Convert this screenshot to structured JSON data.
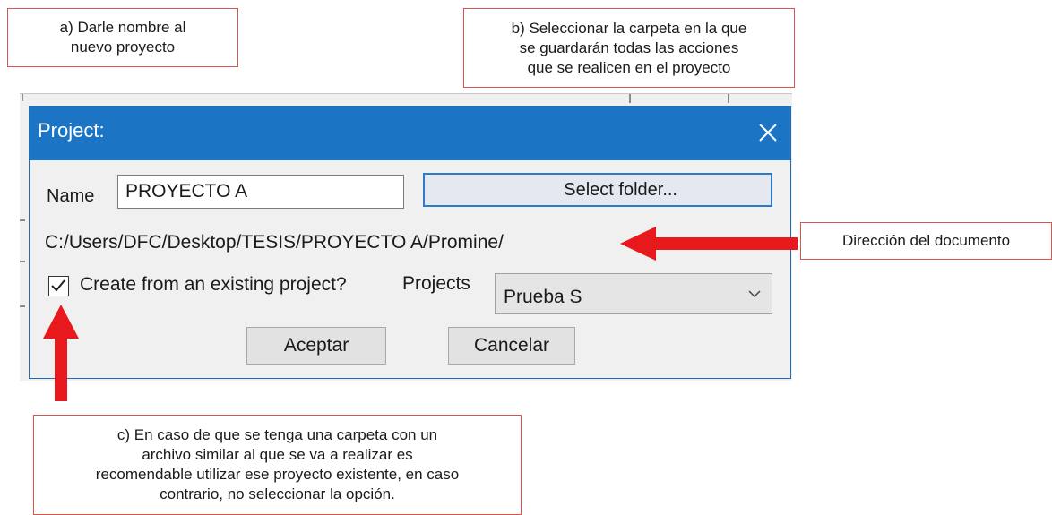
{
  "annotations": {
    "a": "a) Darle nombre al\nnuevo proyecto",
    "b": "b) Seleccionar la carpeta en la que\nse guardarán todas las acciones\nque se realicen en el proyecto",
    "direccion": "Dirección del documento",
    "c": "c) En caso de que se tenga una carpeta con un\narchivo similar al que se va a realizar es\nrecomendable utilizar ese proyecto existente, en caso\ncontrario, no seleccionar la opción."
  },
  "dialog": {
    "title": "Project:",
    "name_label": "Name",
    "name_value": "PROYECTO A",
    "select_folder_label": "Select folder...",
    "path": "C:/Users/DFC/Desktop/TESIS/PROYECTO A/Promine/",
    "checkbox_label": "Create from an existing project?",
    "checkbox_checked": true,
    "projects_label": "Projects",
    "projects_selected": "Prueba S",
    "accept_label": "Aceptar",
    "cancel_label": "Cancelar"
  },
  "colors": {
    "titlebar": "#1c74c4",
    "callout_border": "#d9534f",
    "arrow": "#e8191c"
  }
}
